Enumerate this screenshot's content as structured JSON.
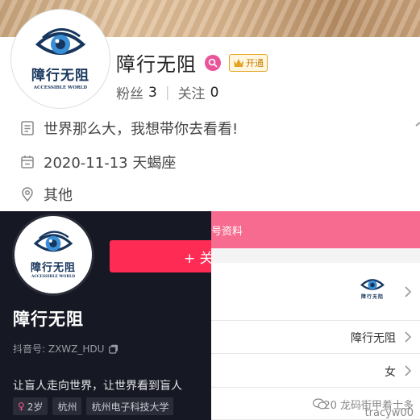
{
  "profile": {
    "name": "障行无阻",
    "logo_cn": "障行无阻",
    "logo_en": "ACCESSIBLE WORLD",
    "vip_label": "开通",
    "fans_label": "粉丝",
    "fans_count": "3",
    "following_label": "关注",
    "following_count": "0",
    "bio": "世界那么大，我想带你去看看!",
    "birth_info": "2020-11-13 天蝎座",
    "location": "其他"
  },
  "douyin": {
    "name": "障行无阻",
    "follow_label": "+ 关",
    "id_text": "抖音号: ZXWZ_HDU",
    "bio": "让盲人走向世界，让世界看到盲人",
    "tags": [
      "2岁",
      "杭州",
      "杭州电子科技大学"
    ]
  },
  "edit_profile": {
    "header_fragment": "号资料",
    "nickname_value": "障行无阻",
    "gender_value": "女"
  },
  "watermark": {
    "line1": "20 龙码街甲着士多",
    "line2": "tracyw00"
  },
  "colors": {
    "douyin_red": "#fe2c55",
    "pink_header": "#f66b8f",
    "logo_navy": "#17365d",
    "badge_pink": "#e9559a"
  }
}
